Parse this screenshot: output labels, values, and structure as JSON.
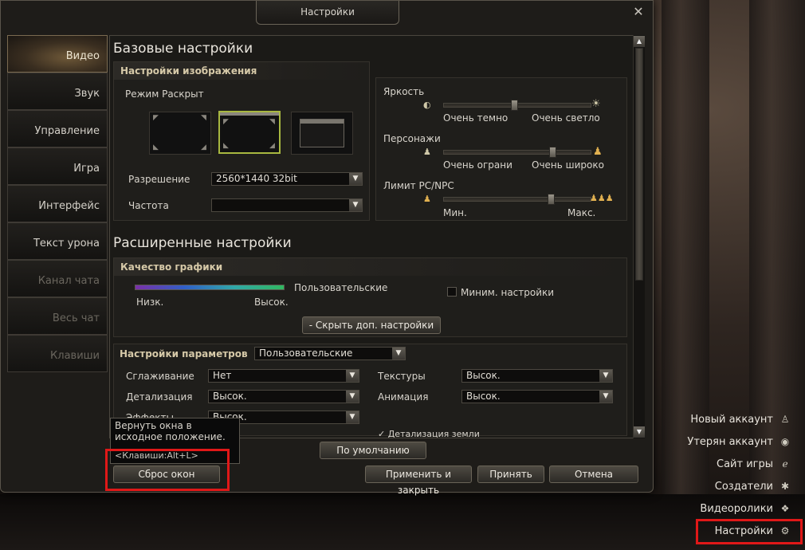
{
  "window": {
    "title": "Настройки",
    "close_icon": "close-icon"
  },
  "tabs": [
    {
      "label": "Видео",
      "state": "active"
    },
    {
      "label": "Звук",
      "state": "normal"
    },
    {
      "label": "Управление",
      "state": "normal"
    },
    {
      "label": "Игра",
      "state": "normal"
    },
    {
      "label": "Интерфейс",
      "state": "normal"
    },
    {
      "label": "Текст урона",
      "state": "normal"
    },
    {
      "label": "Канал чата",
      "state": "disabled"
    },
    {
      "label": "Весь чат",
      "state": "disabled"
    },
    {
      "label": "Клавиши",
      "state": "disabled"
    }
  ],
  "basic": {
    "heading": "Базовые настройки",
    "image_settings": {
      "title": "Настройки изображения",
      "screen_mode_label": "Режим Раскрыт",
      "selected_mode_index": 1,
      "resolution_label": "Разрешение",
      "resolution_value": "2560*1440 32bit",
      "frequency_label": "Частота",
      "frequency_value": ""
    },
    "sliders": {
      "brightness": {
        "label": "Яркость",
        "min_label": "Очень темно",
        "max_label": "Очень светло",
        "value": 0.48
      },
      "characters": {
        "label": "Персонажи",
        "min_label": "Очень ограни",
        "max_label": "Очень широко",
        "value": 0.74
      },
      "pc_npc": {
        "label": "Лимит PC/NPC",
        "min_label": "Мин.",
        "max_label": "Макс.",
        "value": 0.73
      }
    }
  },
  "advanced": {
    "heading": "Расширенные настройки",
    "quality": {
      "title": "Качество графики",
      "preset_value": "Пользовательские",
      "low_label": "Низк.",
      "high_label": "Высок.",
      "min_settings_label": "Миним. настройки",
      "min_settings_checked": false,
      "hide_button": "-  Скрыть доп. настройки"
    },
    "params": {
      "title": "Настройки параметров",
      "preset_value": "Пользовательские",
      "antialias_label": "Сглаживание",
      "antialias_value": "Нет",
      "detail_label": "Детализация",
      "detail_value": "Высок.",
      "effects_label": "Эффекты",
      "effects_value": "Высок.",
      "textures_label": "Текстуры",
      "textures_value": "Высок.",
      "animation_label": "Анимация",
      "animation_value": "Высок.",
      "partial_label": "✓ Детализация земли"
    }
  },
  "buttons": {
    "default": "По умолчанию",
    "reset_windows": "Сброс окон",
    "apply_close": "Применить и закрыть",
    "accept": "Принять",
    "cancel": "Отмена"
  },
  "tooltip": {
    "text": "Вернуть окна в исходное положение.",
    "keys": "<Клавиши:Alt+L>"
  },
  "side_menu": [
    {
      "label": "Новый аккаунт",
      "icon": "user-icon"
    },
    {
      "label": "Утерян аккаунт",
      "icon": "alert-icon"
    },
    {
      "label": "Сайт игры",
      "icon": "browser-icon"
    },
    {
      "label": "Создатели",
      "icon": "credits-icon"
    },
    {
      "label": "Видеоролики",
      "icon": "video-icon"
    },
    {
      "label": "Настройки",
      "icon": "settings-icon"
    }
  ],
  "colors": {
    "highlight_red": "#e01818",
    "selected_mode": "#a8b840"
  }
}
